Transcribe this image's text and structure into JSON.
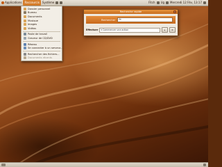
{
  "top_panel": {
    "menus": [
      "Applications",
      "Raccourcis",
      "Système"
    ],
    "active_menu": "Raccourcis",
    "right_items": [
      "Fitch",
      "Ug",
      "Mercredi 12 Fév, 13:17"
    ]
  },
  "places_menu": {
    "items": [
      {
        "label": "Dossier personnel",
        "color": "#d9a55a"
      },
      {
        "label": "Bureau",
        "color": "#8c7b63"
      },
      {
        "label": "Documents",
        "color": "#d9a55a"
      },
      {
        "label": "Musique",
        "color": "#d9a55a"
      },
      {
        "label": "Images",
        "color": "#d9a55a"
      },
      {
        "label": "Vidéos",
        "color": "#d9a55a"
      },
      {
        "label": "Poste de travail",
        "color": "#7c8b98"
      },
      {
        "label": "Graveur de CD/DVD",
        "color": "#9aa5ad"
      },
      {
        "label": "Réseau",
        "color": "#5f82b0"
      },
      {
        "label": "Se connecter à un serveur...",
        "color": "#6e8fb7"
      },
      {
        "label": "Rechercher des fichiers...",
        "color": "#8a8a8a"
      },
      {
        "label": "Documents récents",
        "color": "#b8aa92"
      }
    ]
  },
  "search_window": {
    "title": "Recherche rapide",
    "search_label": "Rechercher",
    "search_value": "fir",
    "action_label": "Effectuer",
    "action_value": "Commencer une action",
    "go_button": "▸"
  }
}
